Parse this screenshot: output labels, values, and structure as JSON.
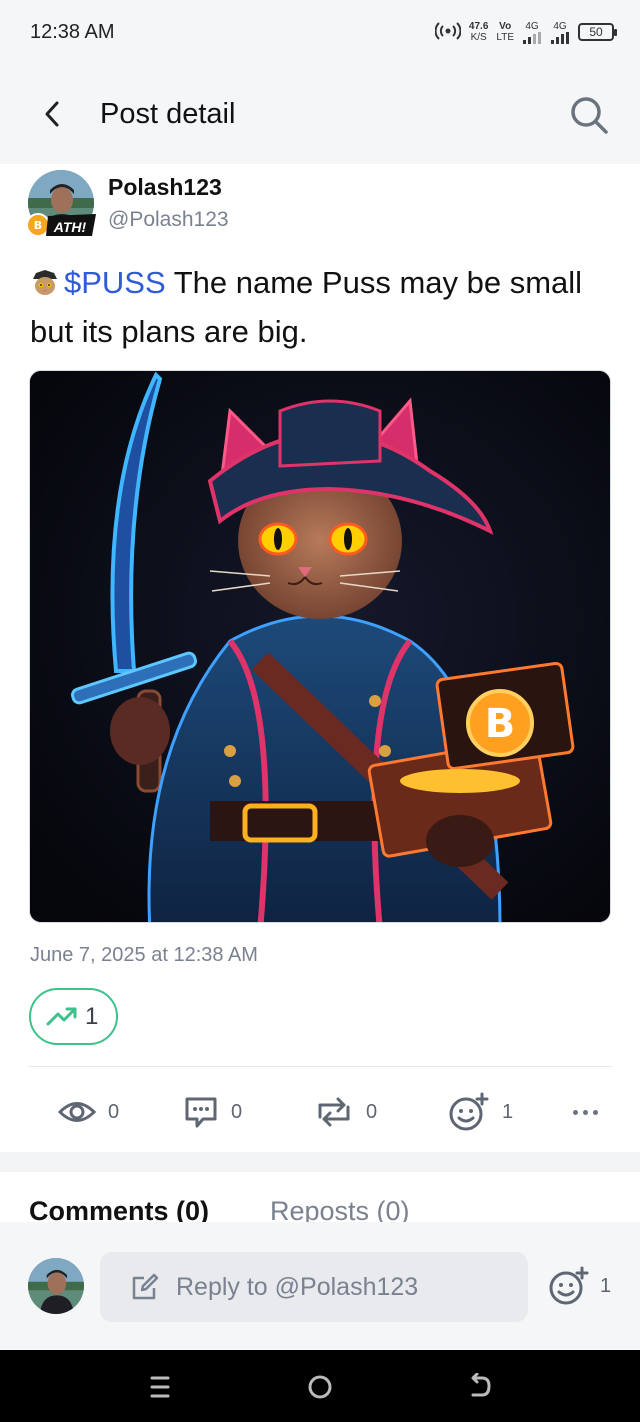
{
  "status_bar": {
    "time": "12:38 AM",
    "net_speed_value": "47.6",
    "net_speed_unit": "K/S",
    "volte_top": "Vo",
    "volte_bottom": "LTE",
    "sim1_label": "4G",
    "sim2_label": "4G",
    "battery": "50"
  },
  "header": {
    "title": "Post detail"
  },
  "post": {
    "author_name": "Polash123",
    "author_handle": "@Polash123",
    "badge_text": "ATH!",
    "ticker": "$PUSS",
    "text": " The name Puss may be small but its plans are big.",
    "timestamp": "June 7, 2025 at 12:38 AM",
    "trend_count": "1",
    "image_alt": "Pirate cat holding a sword and a treasure chest with a bitcoin coin"
  },
  "stats": {
    "views": "0",
    "comments": "0",
    "reposts": "0",
    "reactions": "1"
  },
  "tabs": {
    "comments": "Comments (0)",
    "reposts": "Reposts (0)"
  },
  "reply": {
    "placeholder": "Reply to @Polash123",
    "reaction_count": "1"
  },
  "colors": {
    "accent_link": "#2f5bd6",
    "trend_green": "#3cc28a",
    "muted_text": "#7a8190",
    "header_bg": "#f5f6f8"
  }
}
